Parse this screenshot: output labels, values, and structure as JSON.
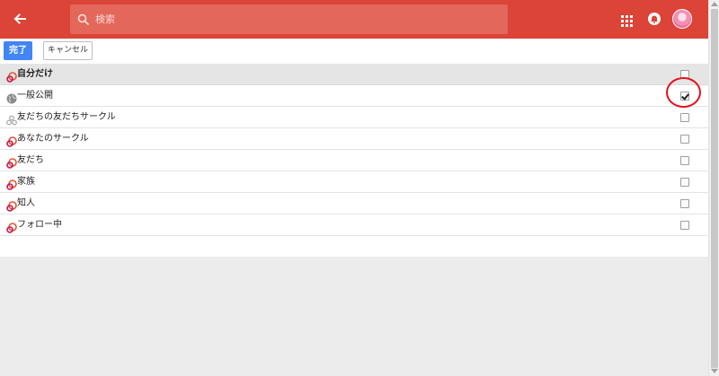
{
  "header": {
    "search_placeholder": "検索",
    "brand_color": "#db4437"
  },
  "toolbar": {
    "done_label": "完了",
    "cancel_label": "キャンセル",
    "accent_color": "#4285f4"
  },
  "audience": {
    "group_label": "自分だけ",
    "group_checked": false,
    "items": [
      {
        "label": "一般公開",
        "icon": "globe-icon",
        "checked": true
      },
      {
        "label": "友だちの友だちサークル",
        "icon": "extended-circles-icon",
        "checked": false
      },
      {
        "label": "あなたのサークル",
        "icon": "circles-icon",
        "checked": false
      },
      {
        "label": "友だち",
        "icon": "circles-icon",
        "checked": false
      },
      {
        "label": "家族",
        "icon": "circles-icon",
        "checked": false
      },
      {
        "label": "知人",
        "icon": "circles-icon",
        "checked": false
      },
      {
        "label": "フォロー中",
        "icon": "circles-icon",
        "checked": false
      }
    ]
  },
  "annotation": {
    "color": "#e3111b",
    "shape": "circle around 一般公開 checkbox"
  }
}
